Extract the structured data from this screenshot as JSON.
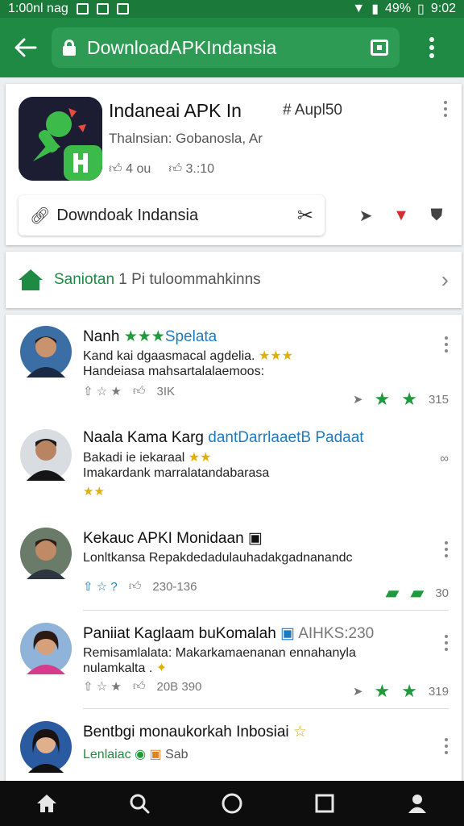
{
  "status": {
    "left_text": "1:00nl nag",
    "battery": "49%",
    "time": "9:02"
  },
  "appbar": {
    "url": "DownloadAPKIndansia"
  },
  "app": {
    "title": "Indaneai APK In",
    "version": "# Aupl50",
    "subtitle": "Thalnsian:  Gobanosla, Ar",
    "likes": "4 ou",
    "dislikes": "3.:10",
    "download_label": "Downdoak Indansia",
    "colors": {
      "icon_bg": "#1c1d33",
      "brand": "#1e8a43"
    }
  },
  "sponsor": {
    "green_text": "Saniotan",
    "grey_text": " 1 Pi tuloommahkinns"
  },
  "reviews": [
    {
      "name": "Nanh",
      "stars": "★★★",
      "tag": "Spelata",
      "line1": "Kand kai dgaasmacal agdelia.",
      "line2": "Handeiasa mahsartalalaemoos:",
      "inline_stars": "★★★",
      "meta1": "⇧ ☆ ★",
      "meta2": "3IK",
      "right_count": "315"
    },
    {
      "name": "Naala Kama Karg",
      "tag": "dantDarrlaaetB Padaat",
      "line1": "Bakadi ie iekaraal",
      "line2": "Imakardank marralatandabarasa",
      "inline_stars": "★★",
      "meta1": "★★",
      "right_count": "∞"
    },
    {
      "name": "Kekauc APKI Monidaan",
      "badge": "▣",
      "line1": "Lonltkansa Repakdedadulauhadakgadnanandc",
      "meta1": "⇧ ☆ ?",
      "meta2": "230-136",
      "right_count": "30"
    },
    {
      "name": "Paniiat Kaglaam buKomalah",
      "tag": "AIHKS:230",
      "line1": "Remisamlalata: Makarkamaenanan ennahanyla",
      "line2": "nulamkalta .",
      "meta1": "⇧ ☆ ★",
      "meta2": "20B 390",
      "right_count": "319"
    },
    {
      "name": "Bentbgi monaukorkah Inbosiai",
      "tag": "Lenlaiac",
      "tag2": "Sab"
    }
  ]
}
